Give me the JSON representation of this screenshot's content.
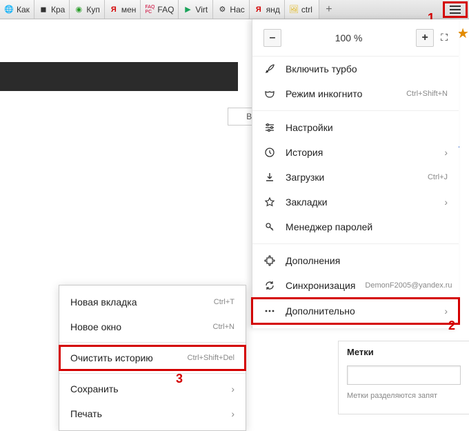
{
  "tabs": [
    {
      "label": "Как",
      "icon": "globe"
    },
    {
      "label": "Кра",
      "icon": "dark"
    },
    {
      "label": "Куп",
      "icon": "green"
    },
    {
      "label": "мен",
      "icon": "ya"
    },
    {
      "label": "FAQ",
      "icon": "faq"
    },
    {
      "label": "Virt",
      "icon": "tri"
    },
    {
      "label": "Нас",
      "icon": "gear"
    },
    {
      "label": "янд",
      "icon": "ya"
    },
    {
      "label": "ctrl",
      "icon": "pic"
    }
  ],
  "newtab_label": "+",
  "callouts": {
    "one": "1",
    "two": "2",
    "three": "3"
  },
  "page_fragments": {
    "vi": "Ви",
    "link": "ь"
  },
  "zoom": {
    "minus": "–",
    "pct": "100 %",
    "plus": "+"
  },
  "menu": {
    "turbo": "Включить турбо",
    "incognito": "Режим инкогнито",
    "incognito_hint": "Ctrl+Shift+N",
    "settings": "Настройки",
    "history": "История",
    "downloads": "Загрузки",
    "downloads_hint": "Ctrl+J",
    "bookmarks": "Закладки",
    "passwords": "Менеджер паролей",
    "addons": "Дополнения",
    "sync": "Синхронизация",
    "sync_hint": "DemonF2005@yandex.ru",
    "more": "Дополнительно"
  },
  "submenu": {
    "newtab": "Новая вкладка",
    "newtab_hint": "Ctrl+T",
    "newwin": "Новое окно",
    "newwin_hint": "Ctrl+N",
    "clear": "Очистить историю",
    "clear_hint": "Ctrl+Shift+Del",
    "save": "Сохранить",
    "print": "Печать"
  },
  "labels": {
    "title": "Метки",
    "placeholder": "",
    "subtext": "Метки разделяются запят"
  }
}
